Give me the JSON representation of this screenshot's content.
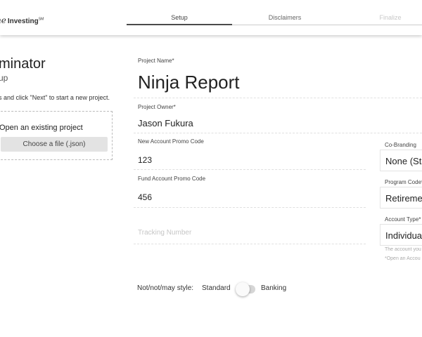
{
  "header": {
    "logo_script": "ne",
    "logo_brand": "Investing",
    "logo_mark": "SM",
    "steps": [
      {
        "label": "Setup",
        "state": "active"
      },
      {
        "label": "Disclaimers",
        "state": "normal"
      },
      {
        "label": "Finalize",
        "state": "disabled"
      }
    ]
  },
  "left": {
    "title": "minator",
    "subtitle": "up",
    "instruction": "s and click \"Next\" to start a new project.",
    "open_title": "Open an existing project",
    "choose_button": "Choose a file (.json)"
  },
  "form": {
    "project_name": {
      "label": "Project Name*",
      "value": "Ninja Report"
    },
    "project_owner": {
      "label": "Project Owner*",
      "value": "Jason Fukura"
    },
    "new_promo": {
      "label": "New Account Promo Code",
      "value": "123"
    },
    "fund_promo": {
      "label": "Fund Account Promo Code",
      "value": "456"
    },
    "tracking": {
      "placeholder": "Tracking Number"
    }
  },
  "right": {
    "co_branding": {
      "label": "Co-Branding",
      "value": "None (Sta"
    },
    "program_code": {
      "label": "Program Code*",
      "value": "Retiremen"
    },
    "account_type": {
      "label": "Account Type*",
      "value": "Individual"
    },
    "note_line1": "The account you",
    "note_line2": "*Open an Accou"
  },
  "style_toggle": {
    "label": "Not/not/may style:",
    "option_left": "Standard",
    "option_right": "Banking",
    "selected": "Standard"
  },
  "colors": {
    "active_step": "#4b4b4b",
    "button_bg": "#e3e3e3",
    "placeholder": "#c6c6c6"
  }
}
